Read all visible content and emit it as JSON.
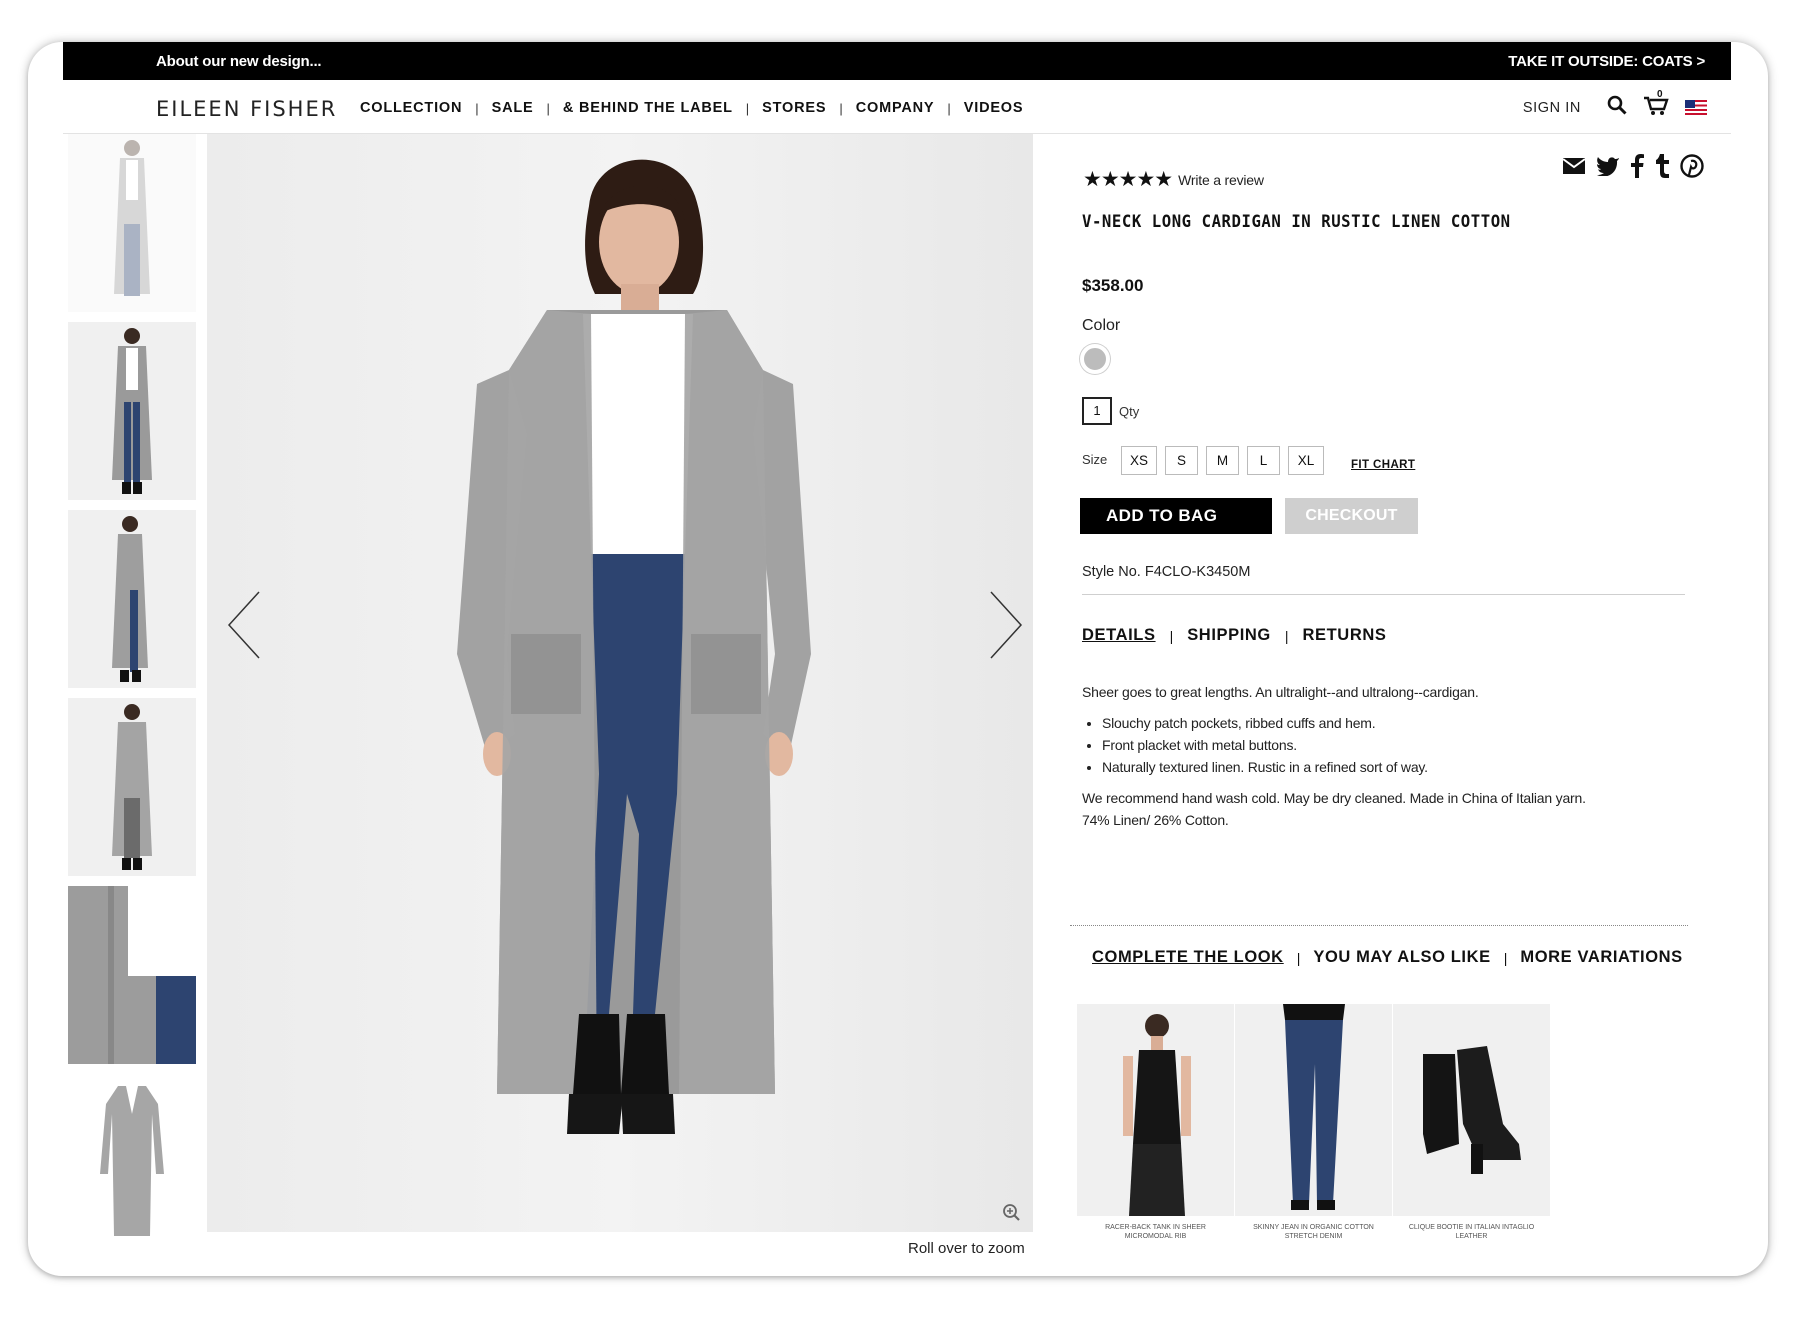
{
  "promo": {
    "left": "About our new design...",
    "right": "TAKE IT OUTSIDE: COATS >"
  },
  "header": {
    "logo": "EILEEN FISHER",
    "nav": [
      "COLLECTION",
      "SALE",
      "& BEHIND THE LABEL",
      "STORES",
      "COMPANY",
      "VIDEOS"
    ],
    "nav_separator": "|",
    "sign_in": "SIGN IN",
    "cart_count": "0",
    "icons": [
      "search-icon",
      "cart-icon",
      "us-flag-icon"
    ]
  },
  "gallery": {
    "thumbnail_count": 6,
    "zoom_hint": "Roll over to zoom"
  },
  "product": {
    "rating_stars": "★★★★★",
    "rating_value": 5,
    "write_review": "Write a review",
    "share_icons": [
      "email-icon",
      "twitter-icon",
      "facebook-icon",
      "tumblr-icon",
      "pinterest-icon"
    ],
    "title": "V-NECK LONG CARDIGAN IN RUSTIC LINEN COTTON",
    "price": "$358.00",
    "color_label": "Color",
    "color_swatch": "#bcbcbc",
    "qty_value": "1",
    "qty_label": "Qty",
    "size_label": "Size",
    "sizes": [
      "XS",
      "S",
      "M",
      "L",
      "XL"
    ],
    "fit_chart": "FIT CHART",
    "add_to_bag": "ADD TO BAG",
    "checkout": "CHECKOUT",
    "style_no": "Style No. F4CLO-K3450M"
  },
  "details_tabs": {
    "tabs": [
      "DETAILS",
      "SHIPPING",
      "RETURNS"
    ],
    "active": "DETAILS",
    "separator": "|"
  },
  "details": {
    "intro": "Sheer goes to great lengths. An ultralight--and ultralong--cardigan.",
    "bullets": [
      "Slouchy patch pockets, ribbed cuffs and hem.",
      "Front placket with metal buttons.",
      "Naturally textured linen. Rustic in a refined sort of way."
    ],
    "care": "We recommend hand wash cold. May be dry cleaned. Made in China of Italian yarn. 74% Linen/ 26% Cotton."
  },
  "recommend_tabs": {
    "tabs": [
      "COMPLETE THE LOOK",
      "YOU MAY ALSO LIKE",
      "MORE VARIATIONS"
    ],
    "active": "COMPLETE THE LOOK",
    "separator": "|"
  },
  "recommendations": [
    {
      "caption": "RACER-BACK TANK IN SHEER MICROMODAL RIB"
    },
    {
      "caption": "SKINNY JEAN IN ORGANIC COTTON STRETCH DENIM"
    },
    {
      "caption": "CLIQUE BOOTIE IN ITALIAN INTAGLIO LEATHER"
    }
  ],
  "colors": {
    "promo_bg": "#000000",
    "accent": "#111111",
    "checkout_disabled": "#cfcfcf",
    "image_bg": "#efeeee"
  }
}
